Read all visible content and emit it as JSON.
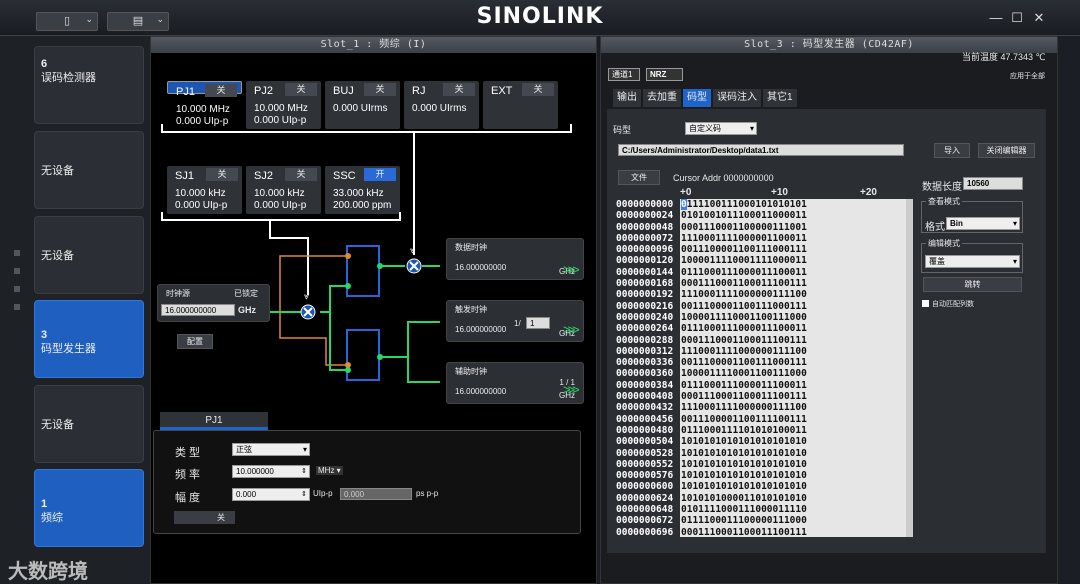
{
  "app": {
    "logo": "SINOLINK",
    "topbtn1": "▯",
    "topbtn2": "▤",
    "minimize": "—",
    "maximize": "☐",
    "close": "✕"
  },
  "sidebar": [
    {
      "num": "6",
      "label": "误码检测器",
      "active": false
    },
    {
      "num": "",
      "label": "无设备",
      "active": false
    },
    {
      "num": "",
      "label": "无设备",
      "active": false
    },
    {
      "num": "3",
      "label": "码型发生器",
      "active": true
    },
    {
      "num": "",
      "label": "无设备",
      "active": false
    },
    {
      "num": "1",
      "label": "频综",
      "active": true
    }
  ],
  "left": {
    "title": "Slot_1 : 频综 (I)",
    "tiles": [
      {
        "name": "PJ1",
        "toggle": "关",
        "l1": "10.000 MHz",
        "l2": "0.000 UIp-p"
      },
      {
        "name": "PJ2",
        "toggle": "关",
        "l1": "10.000 MHz",
        "l2": "0.000 UIp-p"
      },
      {
        "name": "BUJ",
        "toggle": "关",
        "l1": "0.000 UIrms",
        "l2": ""
      },
      {
        "name": "RJ",
        "toggle": "关",
        "l1": "0.000 UIrms",
        "l2": ""
      },
      {
        "name": "EXT",
        "toggle": "关",
        "l1": "",
        "l2": ""
      },
      {
        "name": "SJ1",
        "toggle": "关",
        "l1": "10.000 kHz",
        "l2": "0.000 UIp-p"
      },
      {
        "name": "SJ2",
        "toggle": "关",
        "l1": "10.000 kHz",
        "l2": "0.000 UIp-p"
      },
      {
        "name": "SSC",
        "toggle": "开",
        "l1": "33.000 kHz",
        "l2": "200.000 ppm"
      }
    ],
    "clock_src": {
      "label": "时钟源",
      "status": "已锁定",
      "value": "16.000000000",
      "unit": "GHz",
      "config": "配置"
    },
    "outputs": [
      {
        "name": "数据时钟",
        "value": "16.000000000",
        "unit": "GHz",
        "ratio": ""
      },
      {
        "name": "触发时钟",
        "value": "16.000000000",
        "unit": "GHz",
        "ratio": "1/",
        "div": "1"
      },
      {
        "name": "辅助时钟",
        "value": "16.000000000",
        "unit": "GHz",
        "ratio": "1 / 1"
      }
    ],
    "detail": {
      "tab": "PJ1",
      "type_label": "类 型",
      "type_value": "正弦",
      "freq_label": "频 率",
      "freq_value": "10.000000",
      "freq_unit": "MHz",
      "amp_label": "幅 度",
      "amp_value": "0.000",
      "amp_unit": "UIp-p",
      "amp_value2": "0.000",
      "amp_unit2": "ps p-p",
      "toggle": "关"
    }
  },
  "right": {
    "title": "Slot_3 : 码型发生器 (CD42AF)",
    "temp": "当前温度 47.7343 ℃",
    "channel": "通道1",
    "format": "NRZ",
    "apply_all": "应用于全部",
    "tabs": [
      "输出",
      "去加重",
      "码型",
      "误码注入",
      "其它1"
    ],
    "pattern_label": "码型",
    "pattern_value": "自定义码",
    "path": "C:/Users/Administrator/Desktop/data1.txt",
    "import": "导入",
    "close_editor": "关闭编辑器",
    "file_btn": "文件",
    "cursor": "Cursor Addr 0000000000",
    "col_headers": [
      "+0",
      "+10",
      "+20"
    ],
    "len_label": "数据长度",
    "len_value": "10560",
    "view_group": "查看模式",
    "fmt_label": "格式",
    "fmt_value": "Bin",
    "edit_group": "编辑模式",
    "edit_value": "覆盖",
    "jump": "跳转",
    "auto": "自动匹配列数",
    "rows": [
      [
        "0000000000",
        "0111100111000101010101"
      ],
      [
        "0000000024",
        "0101001011100011000011"
      ],
      [
        "0000000048",
        "0001110001100000111001"
      ],
      [
        "0000000072",
        "1110001111000001100011"
      ],
      [
        "0000000096",
        "0011100001100111000111"
      ],
      [
        "0000000120",
        "1000011110001111000011"
      ],
      [
        "0000000144",
        "0111000111000011100011"
      ],
      [
        "0000000168",
        "0001110001100011100111"
      ],
      [
        "0000000192",
        "1110001111000000111100"
      ],
      [
        "0000000216",
        "0011100001100111000111"
      ],
      [
        "0000000240",
        "1000011110001100111000"
      ],
      [
        "0000000264",
        "0111000111000011100011"
      ],
      [
        "0000000288",
        "0001110001100011100111"
      ],
      [
        "0000000312",
        "1110001111000000111100"
      ],
      [
        "0000000336",
        "0011100001100111000111"
      ],
      [
        "0000000360",
        "1000011110001100111000"
      ],
      [
        "0000000384",
        "0111000111000011100011"
      ],
      [
        "0000000408",
        "0001110001100011100111"
      ],
      [
        "0000000432",
        "1110001111000000111100"
      ],
      [
        "0000000456",
        "0011100001100111100111"
      ],
      [
        "0000000480",
        "0111000111101010100011"
      ],
      [
        "0000000504",
        "1010101010101010101010"
      ],
      [
        "0000000528",
        "1010101010101010101010"
      ],
      [
        "0000000552",
        "1010101010101010101010"
      ],
      [
        "0000000576",
        "1010101010101010101010"
      ],
      [
        "0000000600",
        "1010101010101010101010"
      ],
      [
        "0000000624",
        "1010101000011010101010"
      ],
      [
        "0000000648",
        "0101111000111000011110"
      ],
      [
        "0000000672",
        "0111100011100000111000"
      ],
      [
        "0000000696",
        "0001110001100011100111"
      ]
    ]
  },
  "watermark": "大数跨境"
}
